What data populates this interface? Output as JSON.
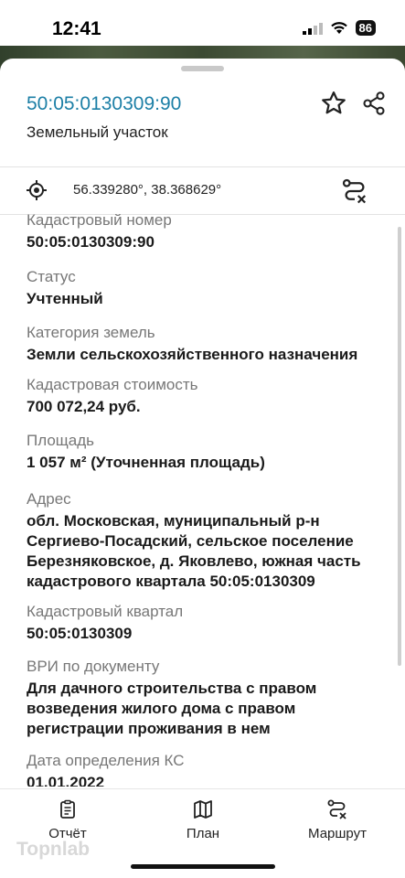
{
  "status_bar": {
    "time": "12:41",
    "battery": "86"
  },
  "header": {
    "title": "50:05:0130309:90",
    "subtitle": "Земельный участок",
    "favorite_icon": "star-outline-icon",
    "share_icon": "share-icon"
  },
  "coords": {
    "icon": "target-location-icon",
    "text": "56.339280°, 38.368629°",
    "route_icon": "route-clear-icon"
  },
  "fields": [
    {
      "label": "Кадастровый номер",
      "value": "50:05:0130309:90"
    },
    {
      "label": "Статус",
      "value": "Учтенный"
    },
    {
      "label": "Категория земель",
      "value": "Земли сельскохозяйственного назначения"
    },
    {
      "label": "Кадастровая стоимость",
      "value": "700 072,24 руб."
    },
    {
      "label": "Площадь",
      "value": "1 057 м² (Уточненная площадь)"
    },
    {
      "label": "Адрес",
      "value": "обл. Московская, муниципальный р-н Сергиево-Посадский, сельское поселение Березняковское, д. Яковлево, южная часть кадастрового квартала 50:05:0130309"
    },
    {
      "label": "Кадастровый квартал",
      "value": "50:05:0130309"
    },
    {
      "label": "ВРИ по документу",
      "value": "Для дачного строительства с правом возведения жилого дома с правом регистрации проживания в нем"
    },
    {
      "label": "Дата определения КС",
      "value": "01.01.2022"
    }
  ],
  "tabs": [
    {
      "label": "Отчёт",
      "icon": "report-clipboard-icon"
    },
    {
      "label": "План",
      "icon": "map-plan-icon"
    },
    {
      "label": "Маршрут",
      "icon": "route-icon"
    }
  ],
  "watermark": "Topnlab"
}
